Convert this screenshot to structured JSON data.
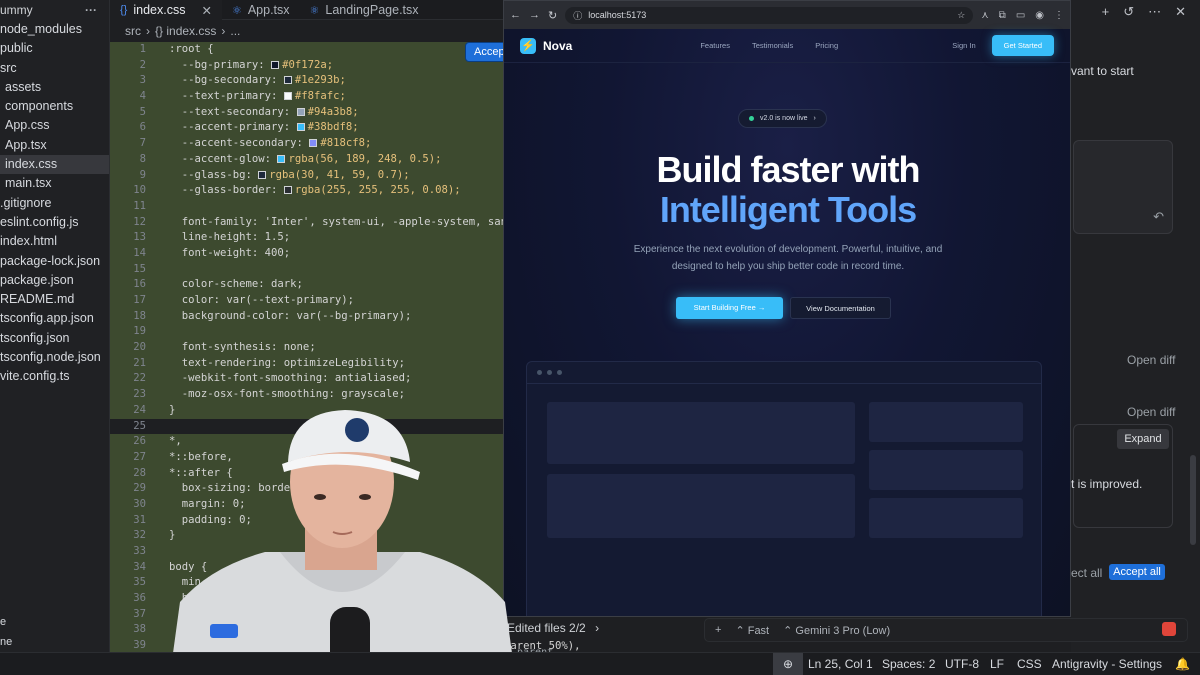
{
  "explorer": {
    "header": "ummy",
    "items": [
      {
        "label": "node_modules",
        "depth": 0
      },
      {
        "label": "public",
        "depth": 0
      },
      {
        "label": "src",
        "depth": 0
      },
      {
        "label": "assets",
        "depth": 1
      },
      {
        "label": "components",
        "depth": 1
      },
      {
        "label": "App.css",
        "depth": 1
      },
      {
        "label": "App.tsx",
        "depth": 1
      },
      {
        "label": "index.css",
        "depth": 1,
        "selected": true
      },
      {
        "label": "main.tsx",
        "depth": 1
      },
      {
        "label": ".gitignore",
        "depth": 0
      },
      {
        "label": "eslint.config.js",
        "depth": 0
      },
      {
        "label": "index.html",
        "depth": 0
      },
      {
        "label": "package-lock.json",
        "depth": 0
      },
      {
        "label": "package.json",
        "depth": 0
      },
      {
        "label": "README.md",
        "depth": 0
      },
      {
        "label": "tsconfig.app.json",
        "depth": 0
      },
      {
        "label": "tsconfig.json",
        "depth": 0
      },
      {
        "label": "tsconfig.node.json",
        "depth": 0
      },
      {
        "label": "vite.config.ts",
        "depth": 0
      }
    ],
    "bottom": [
      "e",
      "ne"
    ]
  },
  "editor": {
    "tabs": [
      {
        "icon": "{}",
        "label": "index.css",
        "active": true
      },
      {
        "icon": "⚛",
        "label": "App.tsx",
        "active": false
      },
      {
        "icon": "⚛",
        "label": "LandingPage.tsx",
        "active": false
      }
    ],
    "breadcrumb": [
      "src",
      "{} index.css",
      "..."
    ],
    "accept_chip": "Accep",
    "lines": [
      {
        "n": "1",
        "t": ":root {",
        "hl": true
      },
      {
        "n": "2",
        "t": "  --bg-primary: ■#0f172a;",
        "hl": true,
        "swatch": "#0f172a"
      },
      {
        "n": "3",
        "t": "  --bg-secondary: ■#1e293b;",
        "hl": true,
        "swatch": "#1e293b"
      },
      {
        "n": "4",
        "t": "  --text-primary: ■#f8fafc;",
        "hl": true,
        "swatch": "#f8fafc"
      },
      {
        "n": "5",
        "t": "  --text-secondary: ■#94a3b8;",
        "hl": true,
        "swatch": "#94a3b8"
      },
      {
        "n": "6",
        "t": "  --accent-primary: ■#38bdf8;",
        "hl": true,
        "swatch": "#38bdf8"
      },
      {
        "n": "7",
        "t": "  --accent-secondary: ■#818cf8;",
        "hl": true,
        "swatch": "#818cf8"
      },
      {
        "n": "8",
        "t": "  --accent-glow: ■rgba(56, 189, 248, 0.5);",
        "hl": true,
        "swatch": "#38bdf8"
      },
      {
        "n": "9",
        "t": "  --glass-bg: ■rgba(30, 41, 59, 0.7);",
        "hl": true,
        "swatch": "#1e293b"
      },
      {
        "n": "10",
        "t": "  --glass-border: ■rgba(255, 255, 255, 0.08);",
        "hl": true,
        "swatch": "#2a2d33"
      },
      {
        "n": "11",
        "t": "",
        "hl": true
      },
      {
        "n": "12",
        "t": "  font-family: 'Inter', system-ui, -apple-system, san",
        "hl": true
      },
      {
        "n": "13",
        "t": "  line-height: 1.5;",
        "hl": true
      },
      {
        "n": "14",
        "t": "  font-weight: 400;",
        "hl": true
      },
      {
        "n": "15",
        "t": "",
        "hl": true
      },
      {
        "n": "16",
        "t": "  color-scheme: dark;",
        "hl": true
      },
      {
        "n": "17",
        "t": "  color: var(--text-primary);",
        "hl": true
      },
      {
        "n": "18",
        "t": "  background-color: var(--bg-primary);",
        "hl": true
      },
      {
        "n": "19",
        "t": "",
        "hl": true
      },
      {
        "n": "20",
        "t": "  font-synthesis: none;",
        "hl": true
      },
      {
        "n": "21",
        "t": "  text-rendering: optimizeLegibility;",
        "hl": true
      },
      {
        "n": "22",
        "t": "  -webkit-font-smoothing: antialiased;",
        "hl": true
      },
      {
        "n": "23",
        "t": "  -moz-osx-font-smoothing: grayscale;",
        "hl": true
      },
      {
        "n": "24",
        "t": "}",
        "hl": true
      },
      {
        "n": "25",
        "t": "",
        "hl": false
      },
      {
        "n": "26",
        "t": "*,",
        "hl": true
      },
      {
        "n": "27",
        "t": "*::before,",
        "hl": true
      },
      {
        "n": "28",
        "t": "*::after {",
        "hl": true
      },
      {
        "n": "29",
        "t": "  box-sizing: borde",
        "hl": true
      },
      {
        "n": "30",
        "t": "  margin: 0;",
        "hl": true
      },
      {
        "n": "31",
        "t": "  padding: 0;",
        "hl": true
      },
      {
        "n": "32",
        "t": "}",
        "hl": true
      },
      {
        "n": "33",
        "t": "",
        "hl": true
      },
      {
        "n": "34",
        "t": "body {",
        "hl": true
      },
      {
        "n": "35",
        "t": "  min-heigh",
        "hl": true
      },
      {
        "n": "36",
        "t": "  backgrou",
        "hl": true
      },
      {
        "n": "37",
        "t": "    radial",
        "hl": true
      },
      {
        "n": "38",
        "t": "    r",
        "hl": true
      },
      {
        "n": "39",
        "t": "",
        "hl": true
      }
    ]
  },
  "browser": {
    "url": "localhost:5173",
    "site": {
      "brand": "Nova",
      "nav_links": [
        "Features",
        "Testimonials",
        "Pricing"
      ],
      "sign_in": "Sign In",
      "get_started": "Get Started",
      "pill": "v2.0 is now live",
      "headline_1": "Build faster with",
      "headline_2": "Intelligent Tools",
      "subtitle": "Experience the next evolution of development. Powerful, intuitive, and designed to help you ship better code in record time.",
      "cta_primary": "Start Building Free →",
      "cta_secondary": "View Documentation"
    }
  },
  "chat": {
    "partial_text_1": "vant to start",
    "open_diff_1": "Open diff",
    "open_diff_2": "Open diff",
    "expand": "Expand",
    "partial_text_2": "t is improved.",
    "reject_all_partial": "ect all",
    "accept_all": "Accept all",
    "input_plus": "+",
    "mode": "Fast",
    "model": "Gemini 3 Pro (Low)"
  },
  "edited_files": "Edited files 2/2",
  "code_overlay": {
    "line_a": "parent",
    "line_b": "parent 50%),"
  },
  "status": {
    "position": "Ln 25, Col 1",
    "spaces": "Spaces: 2",
    "encoding": "UTF-8",
    "eol": "LF",
    "language": "CSS",
    "settings": "Antigravity - Settings"
  },
  "colors": {
    "accent": "#38bdf8",
    "vscode_blue": "#1e6fd9"
  }
}
